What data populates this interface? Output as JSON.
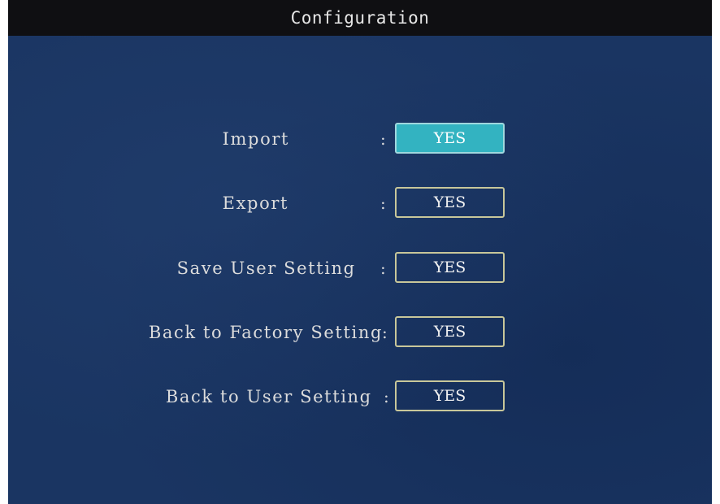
{
  "window": {
    "title": "Configuration"
  },
  "settings": [
    {
      "label": "Import",
      "colon": ":",
      "button": "YES",
      "selected": true
    },
    {
      "label": "Export",
      "colon": ":",
      "button": "YES",
      "selected": false
    },
    {
      "label": "Save User Setting ",
      "colon": ":",
      "button": "YES",
      "selected": false
    },
    {
      "label": "Back to Factory Setting",
      "colon": ":",
      "button": "YES",
      "selected": false
    },
    {
      "label": "Back to User Setting ",
      "colon": ":",
      "button": "YES",
      "selected": false
    }
  ],
  "colors": {
    "background": "#1a3562",
    "title_bar": "#0f0f12",
    "selected_button": "#33b3c1",
    "button_border": "#c8c79a"
  }
}
